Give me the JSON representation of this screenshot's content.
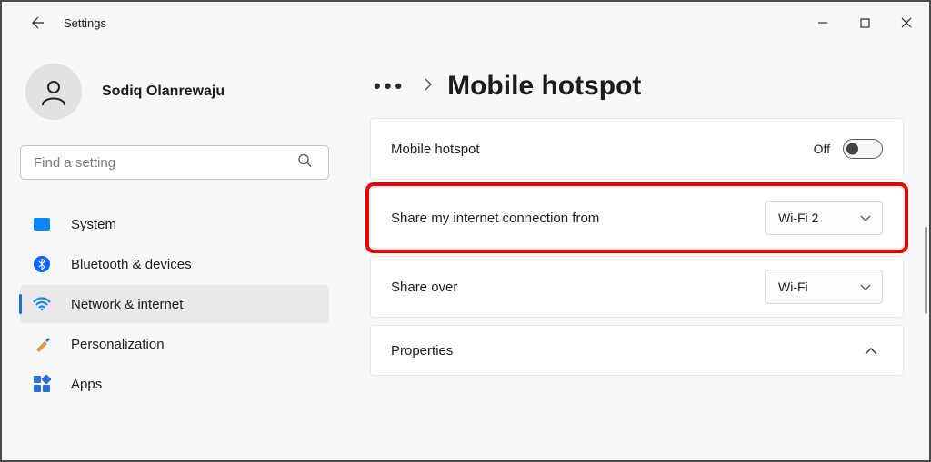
{
  "app_title": "Settings",
  "user": {
    "name": "Sodiq Olanrewaju"
  },
  "search": {
    "placeholder": "Find a setting"
  },
  "sidebar": {
    "items": [
      {
        "label": "System"
      },
      {
        "label": "Bluetooth & devices"
      },
      {
        "label": "Network & internet"
      },
      {
        "label": "Personalization"
      },
      {
        "label": "Apps"
      }
    ],
    "selected_index": 2
  },
  "breadcrumb": {
    "page_title": "Mobile hotspot"
  },
  "rows": {
    "hotspot_label": "Mobile hotspot",
    "hotspot_state": "Off",
    "share_from_label": "Share my internet connection from",
    "share_from_value": "Wi-Fi 2",
    "share_over_label": "Share over",
    "share_over_value": "Wi-Fi",
    "properties_label": "Properties"
  }
}
